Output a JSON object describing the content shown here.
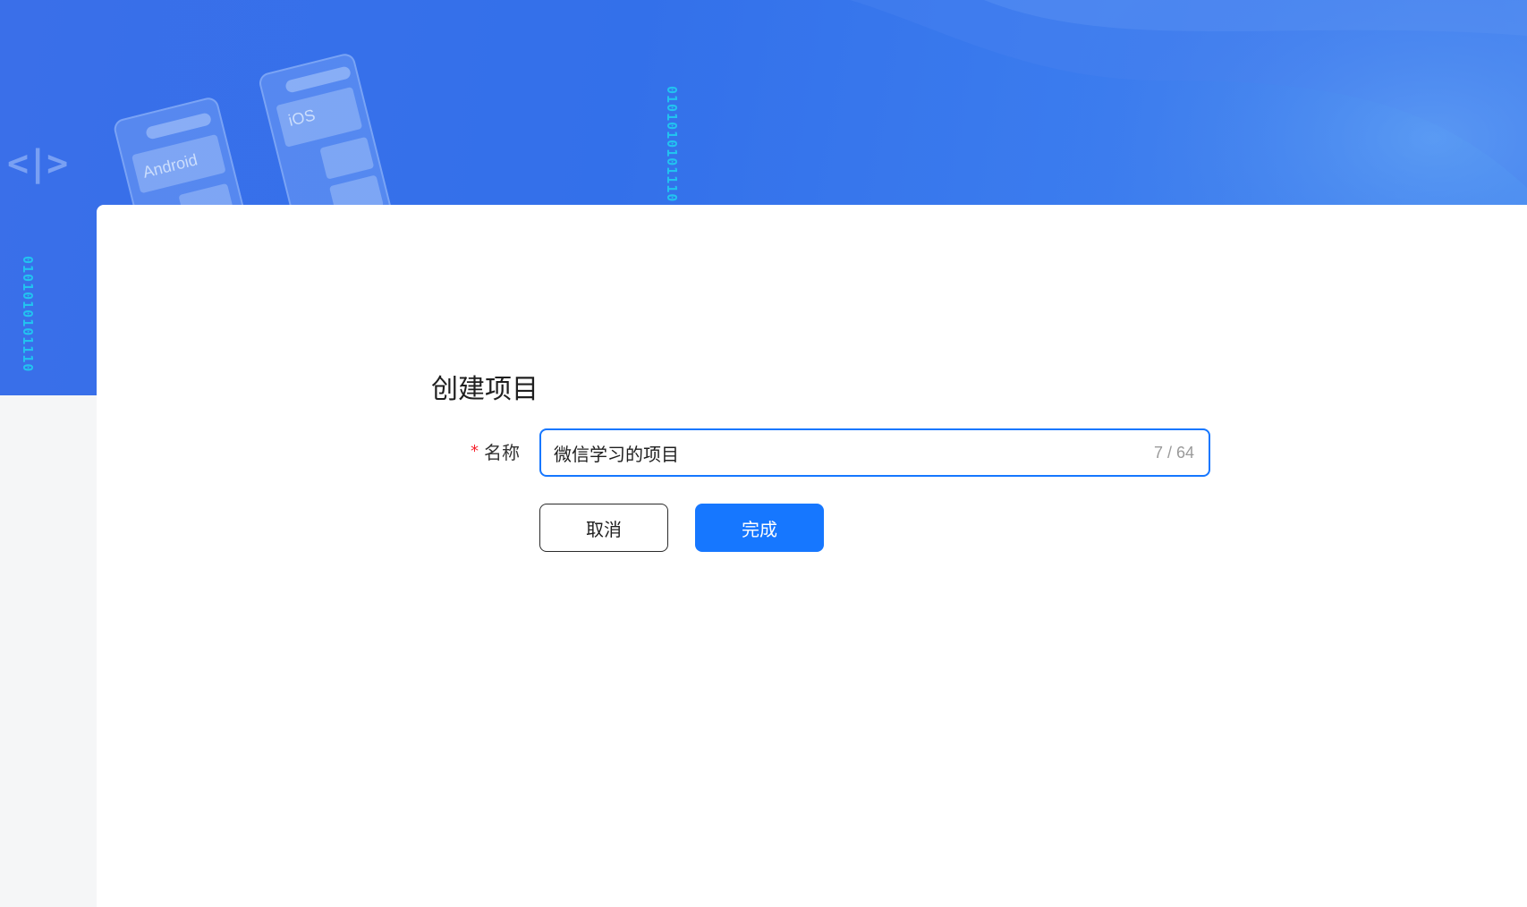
{
  "banner": {
    "binary_text_1": "0101010101110",
    "binary_text_2": "0101010101110",
    "code_glyph": "<|>",
    "phone_android_label": "Android",
    "phone_ios_label": "iOS"
  },
  "dialog": {
    "title": "创建项目",
    "name_field": {
      "required_mark": "*",
      "label": "名称",
      "value": "微信学习的项目",
      "counter": "7 / 64"
    },
    "buttons": {
      "cancel": "取消",
      "confirm": "完成"
    }
  },
  "colors": {
    "primary": "#1677ff",
    "banner": "#3370ea",
    "required": "#f5222d"
  }
}
